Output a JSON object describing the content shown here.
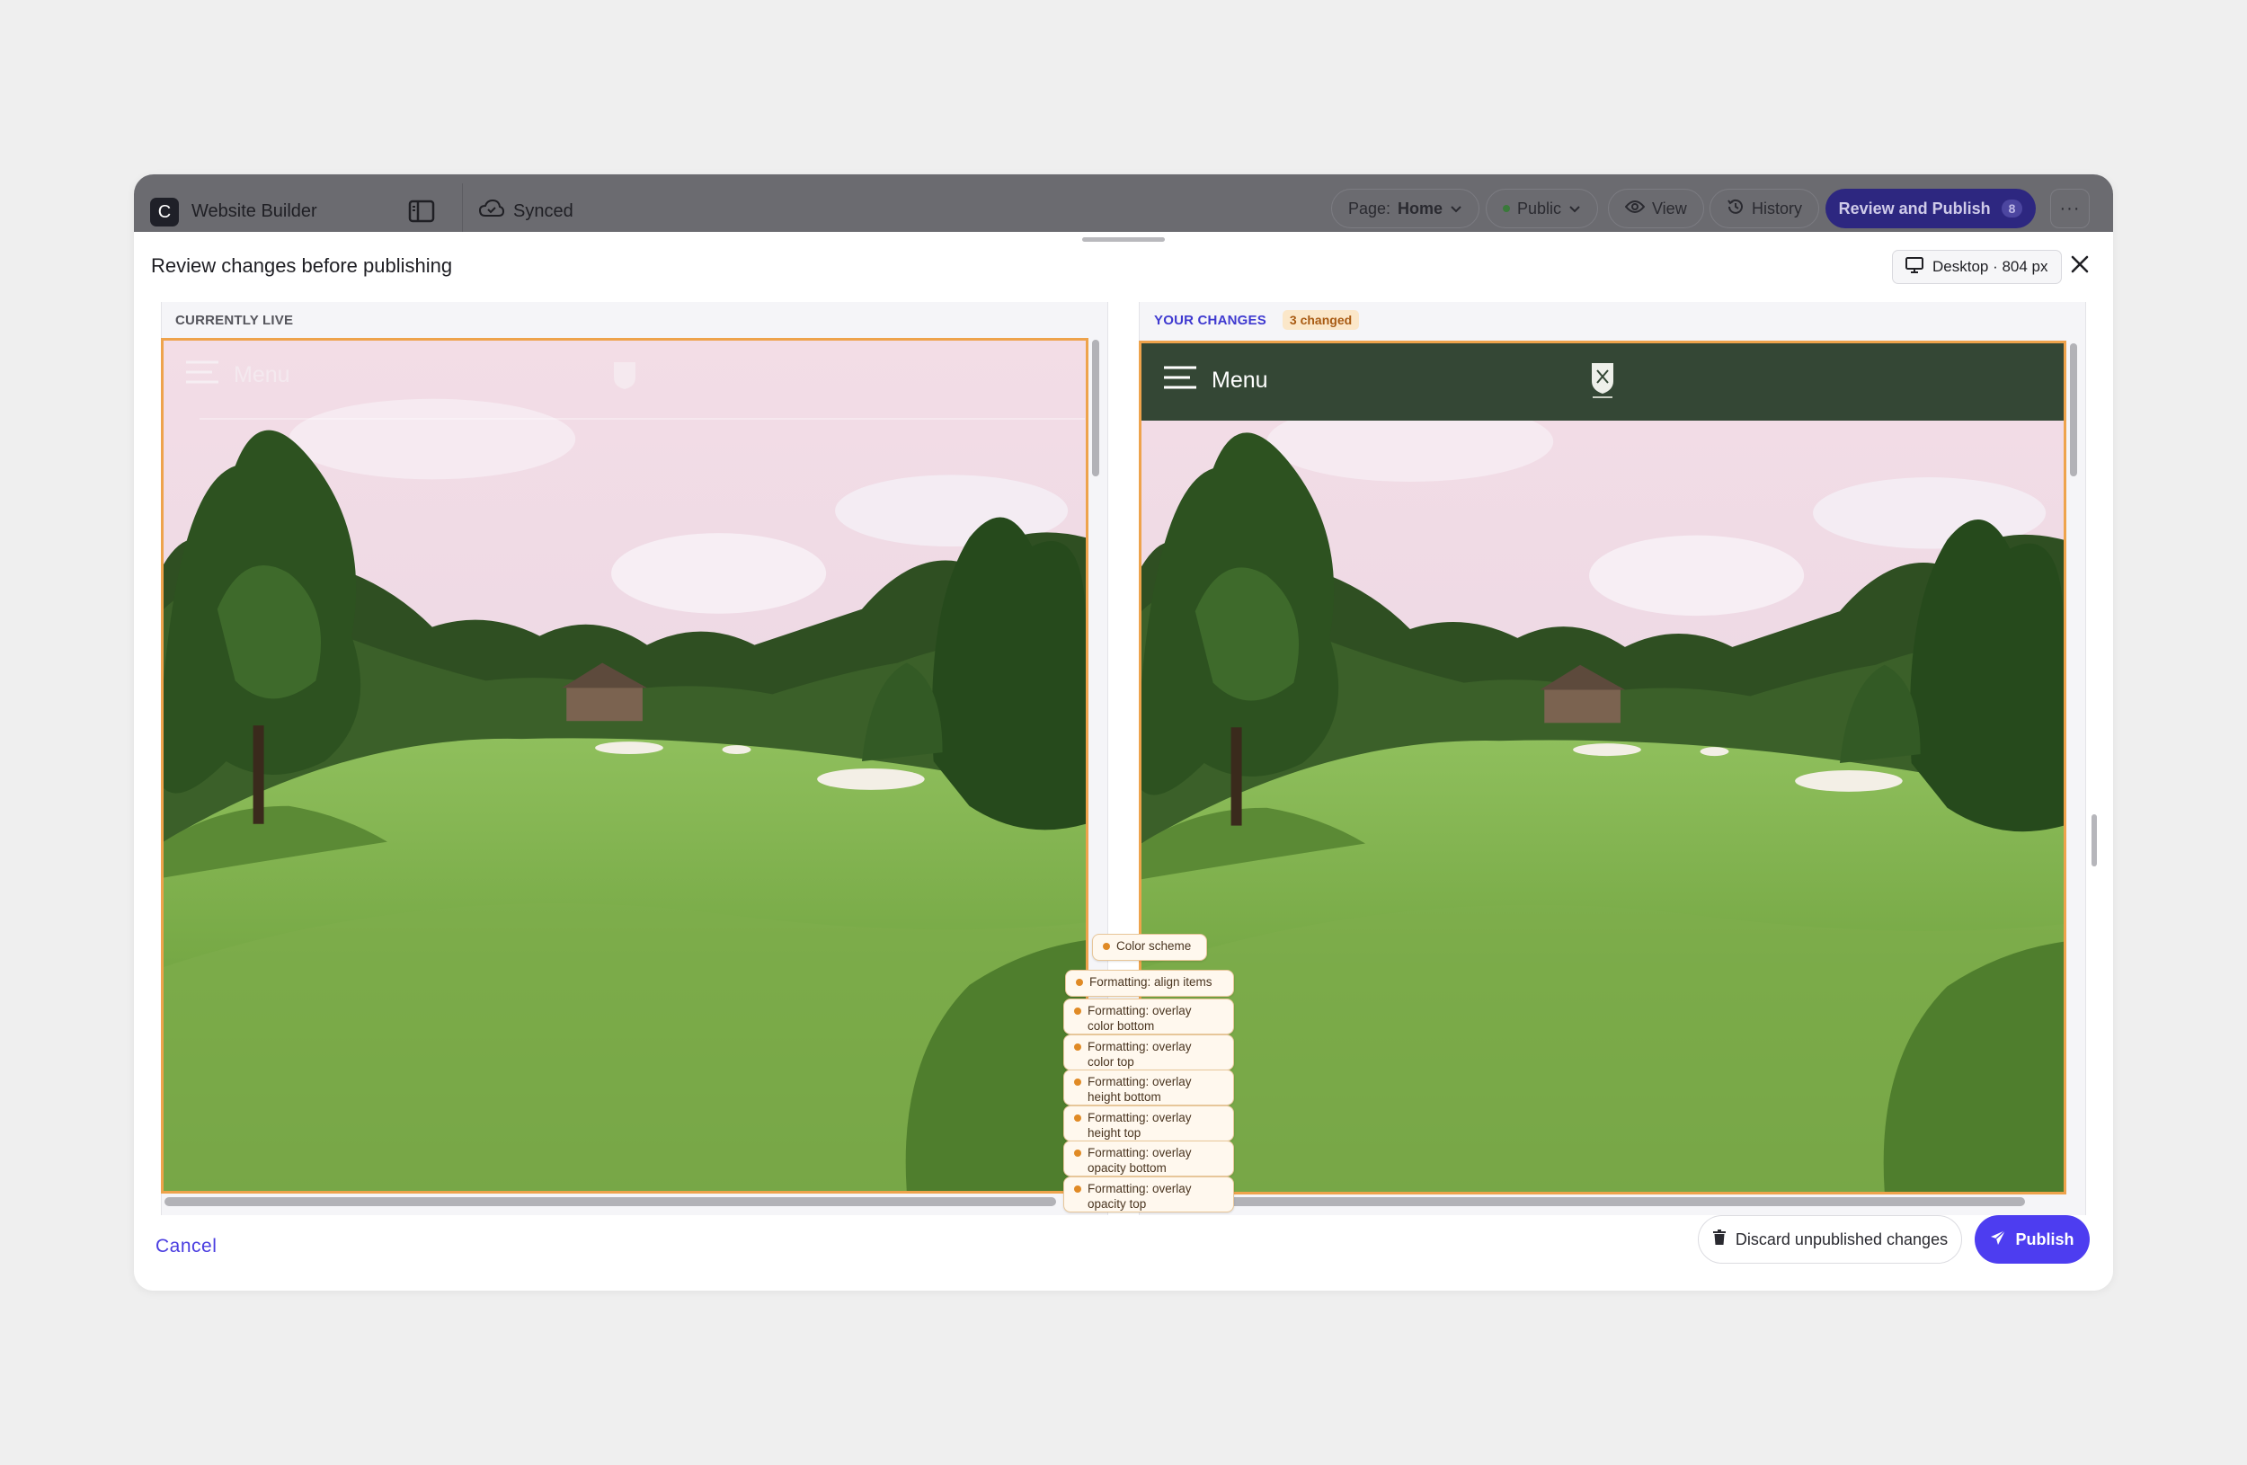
{
  "app": {
    "logo_letter": "C",
    "name": "Website Builder",
    "sync_status": "Synced"
  },
  "toolbar": {
    "page_label": "Page:",
    "page_value": "Home",
    "visibility": "Public",
    "view_label": "View",
    "history_label": "History",
    "review_publish_label": "Review and Publish",
    "review_publish_count": "8",
    "more_label": "···"
  },
  "review": {
    "title": "Review changes before publishing",
    "device_label": "Desktop · 804 px",
    "live_label": "CURRENTLY LIVE",
    "changes_label": "YOUR CHANGES",
    "changed_badge": "3 changed",
    "menu_label": "Menu"
  },
  "change_tags": [
    {
      "line1": "Color scheme",
      "line2": ""
    },
    {
      "line1": "Formatting: align items",
      "line2": ""
    },
    {
      "line1": "Formatting: overlay",
      "line2": "color bottom"
    },
    {
      "line1": "Formatting: overlay",
      "line2": "color top"
    },
    {
      "line1": "Formatting: overlay",
      "line2": "height bottom"
    },
    {
      "line1": "Formatting: overlay",
      "line2": "height top"
    },
    {
      "line1": "Formatting: overlay",
      "line2": "opacity bottom"
    },
    {
      "line1": "Formatting: overlay",
      "line2": "opacity top"
    }
  ],
  "footer": {
    "cancel_label": "Cancel",
    "discard_label": "Discard unpublished changes",
    "publish_label": "Publish"
  },
  "colors": {
    "accent": "#4d3df0",
    "changed_outline": "#eea34c",
    "header_green": "#344735"
  }
}
